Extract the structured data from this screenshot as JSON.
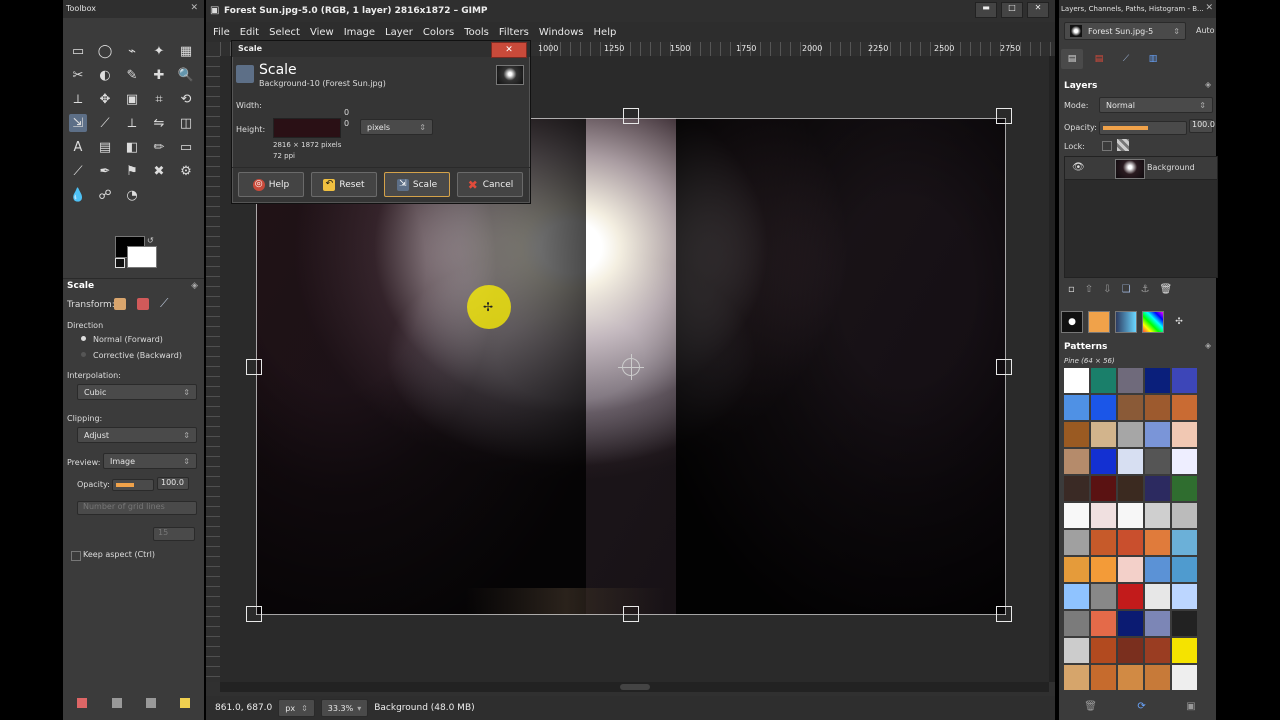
{
  "toolbox": {
    "title": "Toolbox",
    "scale_title": "Scale",
    "transform_label": "Transform:",
    "direction_label": "Direction",
    "normal": "Normal (Forward)",
    "corrective": "Corrective (Backward)",
    "interpolation_label": "Interpolation:",
    "interpolation_value": "Cubic",
    "clipping_label": "Clipping:",
    "clipping_value": "Adjust",
    "preview_label": "Preview:",
    "preview_value": "Image",
    "opacity_label": "Opacity:",
    "opacity_value": "100.0",
    "grid_lines": "Number of grid lines",
    "grid_value": "15",
    "keep_aspect": "Keep aspect  (Ctrl)"
  },
  "main": {
    "title": "Forest Sun.jpg-5.0 (RGB, 1 layer) 2816x1872 – GIMP",
    "menu": [
      "File",
      "Edit",
      "Select",
      "View",
      "Image",
      "Layer",
      "Colors",
      "Tools",
      "Filters",
      "Windows",
      "Help"
    ],
    "ruler_ticks": [
      "1000",
      "1250",
      "1500",
      "1750",
      "2000",
      "2250",
      "2500",
      "2750"
    ],
    "status": {
      "coords": "861.0, 687.0",
      "unit": "px",
      "zoom": "33.3%",
      "layer": "Background (48.0 MB)"
    }
  },
  "dialog": {
    "title": "Scale",
    "heading": "Scale",
    "subheading": "Background-10 (Forest Sun.jpg)",
    "width_label": "Width:",
    "height_label": "Height:",
    "width_value": "0",
    "height_value": "0",
    "unit": "pixels",
    "dims": "2816 × 1872 pixels",
    "ppi": "72 ppi",
    "buttons": {
      "help": "Help",
      "reset": "Reset",
      "scale": "Scale",
      "cancel": "Cancel"
    }
  },
  "right": {
    "title": "Layers, Channels, Paths, Histogram - B...",
    "image_selector": "Forest Sun.jpg-5",
    "auto": "Auto",
    "layers_label": "Layers",
    "mode_label": "Mode:",
    "mode_value": "Normal",
    "opacity_label": "Opacity:",
    "opacity_value": "100.0",
    "lock_label": "Lock:",
    "layer_name": "Background",
    "patterns_label": "Patterns",
    "pattern_name": "Pine (64 × 56)"
  },
  "colors": {
    "accent": "#5d6f87",
    "bg": "#3b3b3b",
    "dark": "#232323"
  }
}
